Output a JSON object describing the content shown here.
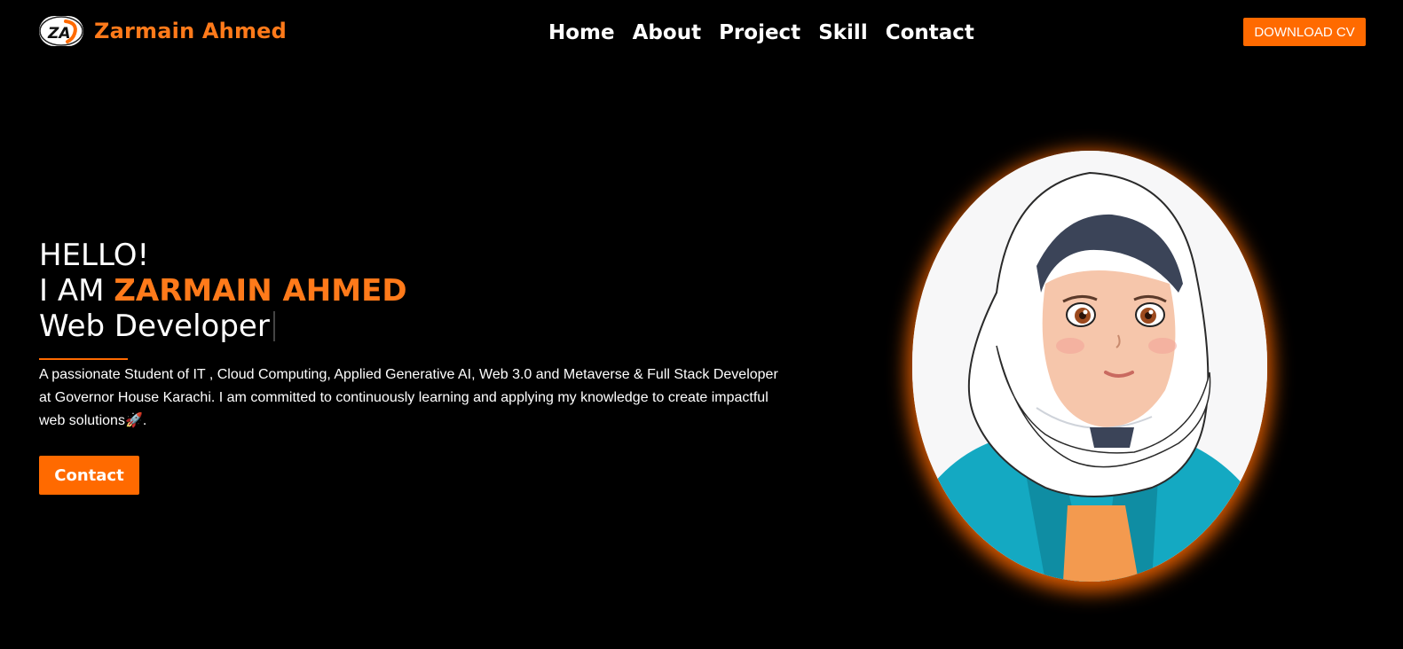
{
  "header": {
    "logo_text": "ZA",
    "brand_name": "Zarmain Ahmed",
    "nav": [
      "Home",
      "About",
      "Project",
      "Skill",
      "Contact"
    ],
    "download_cv": "DOWNLOAD CV"
  },
  "hero": {
    "greeting": "HELLO!",
    "i_am": "I AM ",
    "name": "ZARMAIN AHMED",
    "role": "Web Developer",
    "description": "A passionate Student of IT , Cloud Computing, Applied Generative AI, Web 3.0 and Metaverse & Full Stack Developer at Governor House Karachi. I am committed to continuously learning and applying my knowledge to create impactful web solutions🚀.",
    "contact_button": "Contact"
  },
  "colors": {
    "accent": "#ff6a00",
    "brand_text": "#ff7a1a",
    "background": "#000000",
    "text": "#ffffff"
  },
  "icons": {
    "logo": "za-logo-icon",
    "avatar": "avatar-illustration"
  }
}
